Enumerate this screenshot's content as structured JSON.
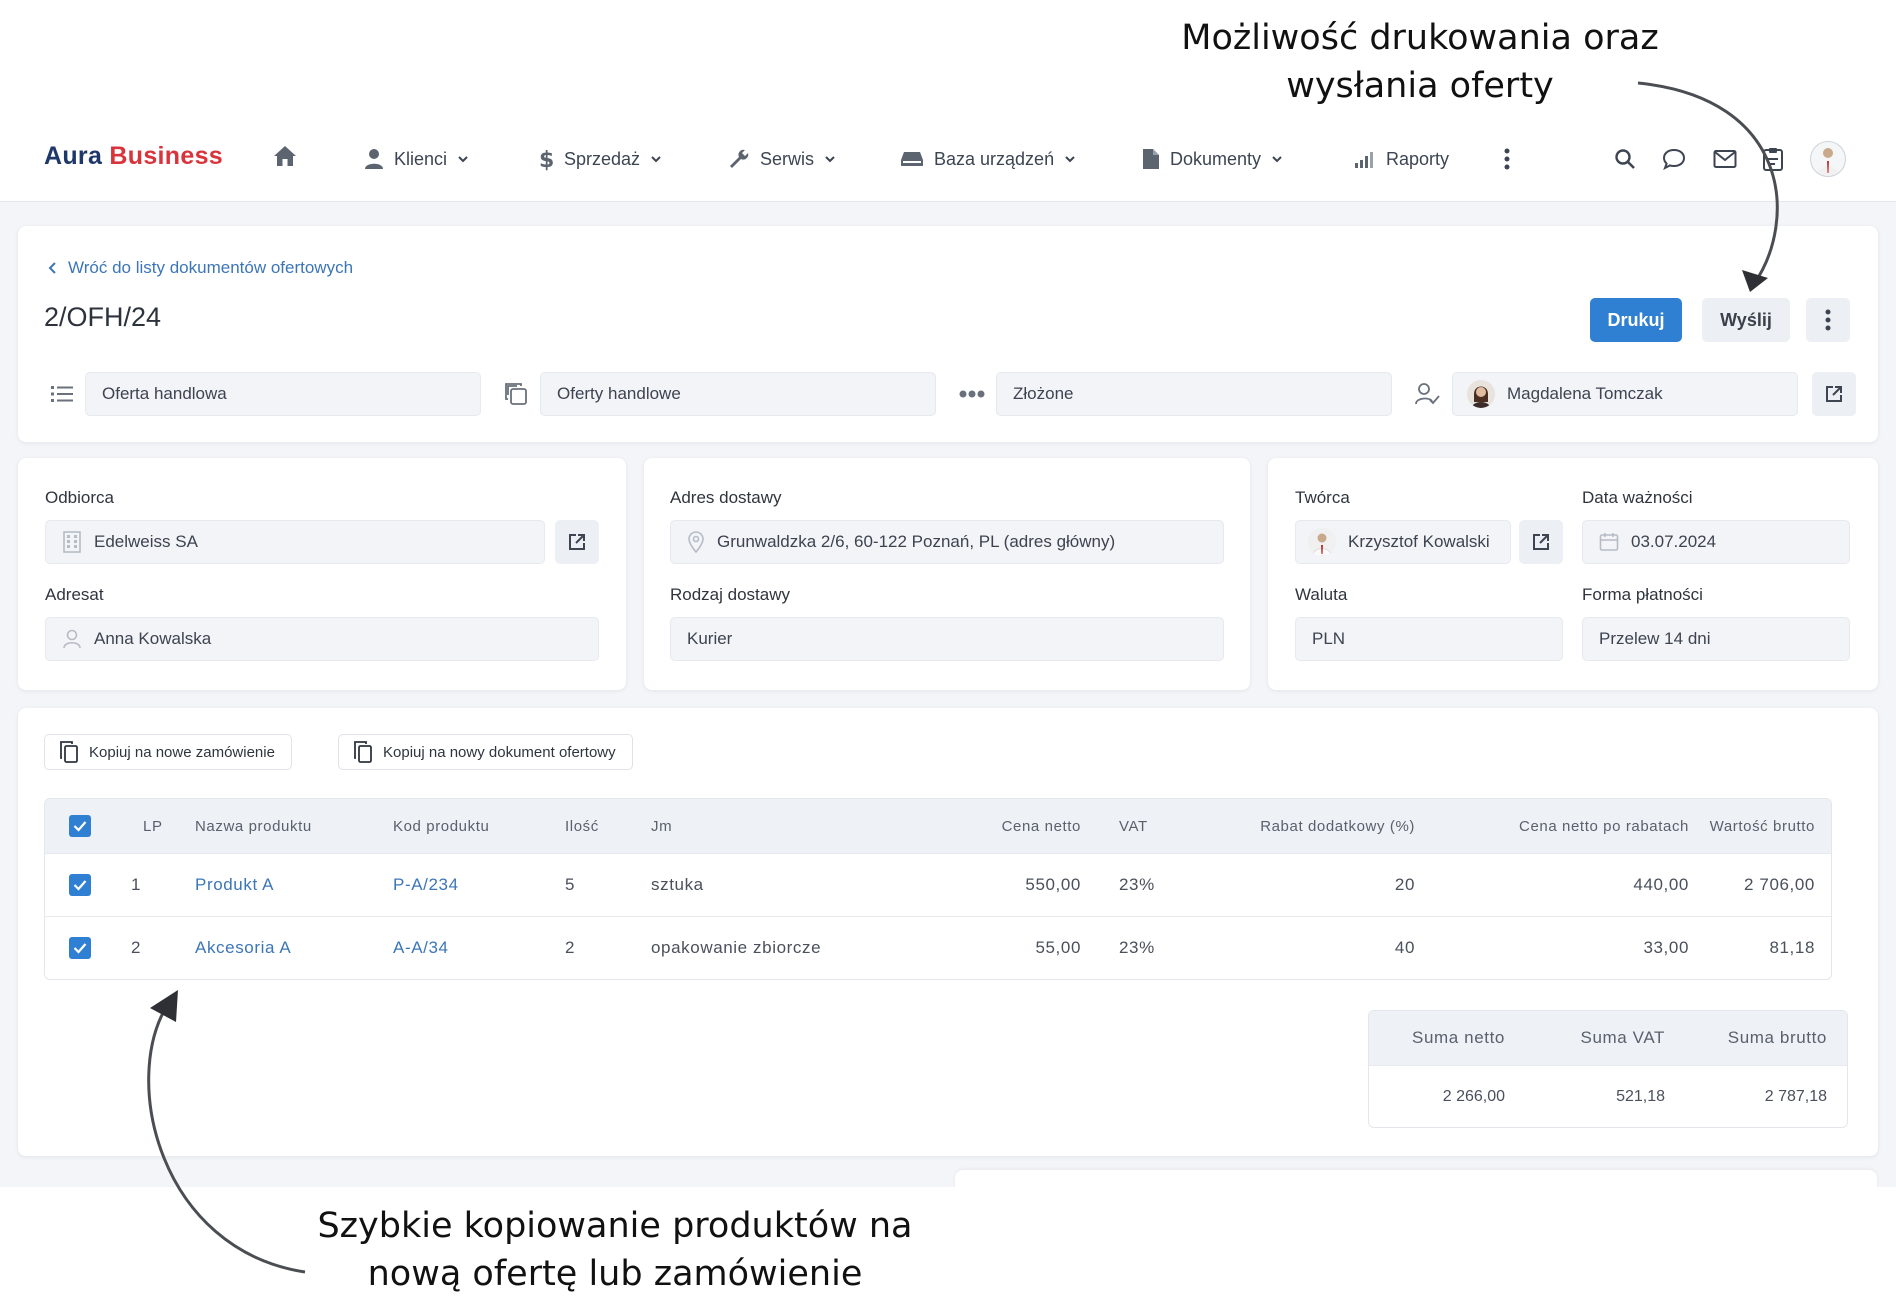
{
  "annotations": {
    "top_line1": "Możliwość drukowania oraz",
    "top_line2": "wysłania oferty",
    "bottom_line1": "Szybkie kopiowanie produktów na",
    "bottom_line2": "nową ofertę lub zamówienie"
  },
  "nav": {
    "logo_part1": "Aura",
    "logo_part2": "Business",
    "items": [
      {
        "label": "Klienci",
        "icon": "user-icon"
      },
      {
        "label": "Sprzedaż",
        "icon": "dollar-icon"
      },
      {
        "label": "Serwis",
        "icon": "wrench-icon"
      },
      {
        "label": "Baza urządzeń",
        "icon": "device-icon"
      },
      {
        "label": "Dokumenty",
        "icon": "document-icon"
      },
      {
        "label": "Raporty",
        "icon": "signal-bars-icon"
      }
    ]
  },
  "header": {
    "back_label": "Wróć do listy dokumentów ofertowych",
    "doc_number": "2/OFH/24",
    "print_label": "Drukuj",
    "send_label": "Wyślij",
    "doc_type": "Oferta handlowa",
    "category": "Oferty handlowe",
    "status": "Złożone",
    "owner": "Magdalena Tomczak"
  },
  "recipient": {
    "odbiorca_label": "Odbiorca",
    "odbiorca_value": "Edelweiss SA",
    "adresat_label": "Adresat",
    "adresat_value": "Anna Kowalska"
  },
  "delivery": {
    "address_label": "Adres dostawy",
    "address_value": "Grunwaldzka 2/6, 60-122 Poznań, PL (adres główny)",
    "type_label": "Rodzaj dostawy",
    "type_value": "Kurier"
  },
  "meta": {
    "creator_label": "Twórca",
    "creator_value": "Krzysztof Kowalski",
    "validity_label": "Data ważności",
    "validity_value": "03.07.2024",
    "currency_label": "Waluta",
    "currency_value": "PLN",
    "payment_label": "Forma płatności",
    "payment_value": "Przelew 14 dni"
  },
  "items": {
    "copy_order_label": "Kopiuj na nowe zamówienie",
    "copy_offer_label": "Kopiuj na nowy dokument ofertowy",
    "columns": {
      "lp": "LP",
      "name": "Nazwa produktu",
      "code": "Kod produktu",
      "qty": "Ilość",
      "unit": "Jm",
      "net": "Cena netto",
      "vat": "VAT",
      "discount": "Rabat dodatkowy (%)",
      "net_after": "Cena netto po rabatach",
      "gross": "Wartość brutto"
    },
    "rows": [
      {
        "lp": "1",
        "name": "Produkt A",
        "code": "P-A/234",
        "qty": "5",
        "unit": "sztuka",
        "net": "550,00",
        "vat": "23%",
        "discount": "20",
        "net_after": "440,00",
        "gross": "2 706,00"
      },
      {
        "lp": "2",
        "name": "Akcesoria A",
        "code": "A-A/34",
        "qty": "2",
        "unit": "opakowanie zbiorcze",
        "net": "55,00",
        "vat": "23%",
        "discount": "40",
        "net_after": "33,00",
        "gross": "81,18"
      }
    ],
    "summary": {
      "net_label": "Suma netto",
      "vat_label": "Suma VAT",
      "gross_label": "Suma brutto",
      "net_value": "2 266,00",
      "vat_value": "521,18",
      "gross_value": "2 787,18"
    }
  },
  "colors": {
    "primary": "#2f7fd3",
    "brand_dark": "#1f3769",
    "brand_red": "#d9343b",
    "link": "#3c76b8"
  }
}
